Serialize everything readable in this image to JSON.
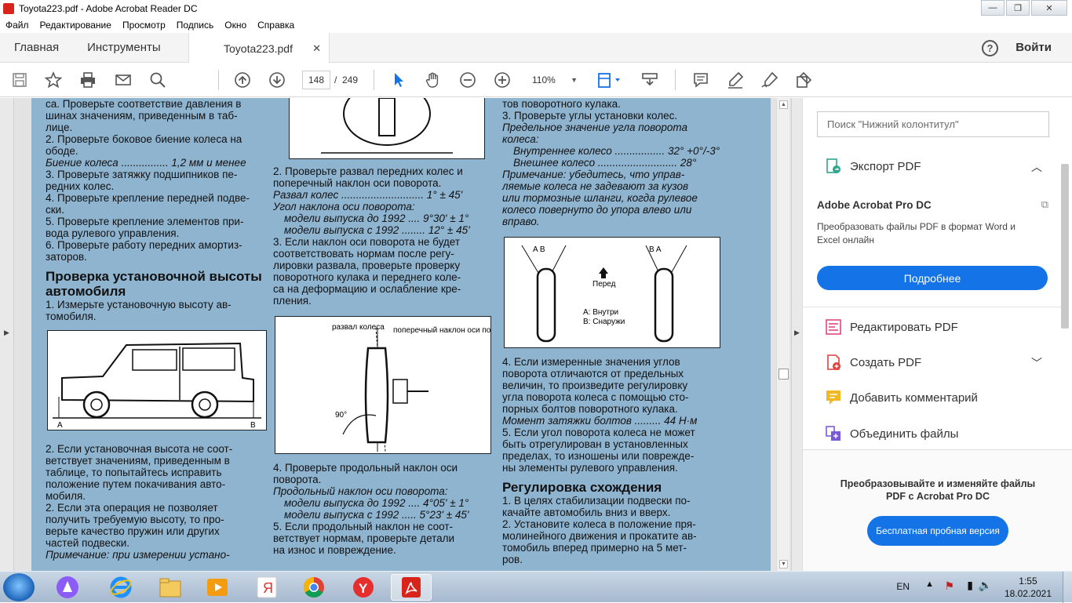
{
  "window": {
    "title": "Toyota223.pdf - Adobe Acrobat Reader DC",
    "minimize": "—",
    "maximize": "❐",
    "close": "✕"
  },
  "menu": [
    "Файл",
    "Редактирование",
    "Просмотр",
    "Подпись",
    "Окно",
    "Справка"
  ],
  "tabs": {
    "home": "Главная",
    "tools": "Инструменты",
    "document": "Toyota223.pdf",
    "close": "✕",
    "signin": "Войти"
  },
  "toolbar": {
    "page_current": "148",
    "page_separator": "/",
    "page_total": "249",
    "zoom": "110%"
  },
  "document": {
    "col1": [
      "са. Проверьте соответствие давления в",
      "шинах значениям, приведенным в таб-",
      "лице.",
      "2. Проверьте боковое биение колеса на",
      "ободе.",
      "Биение колеса ................ 1,2 мм и менее",
      "3. Проверьте затяжку подшипников пе-",
      "редних колес.",
      "4. Проверьте крепление передней подве-",
      "ски.",
      "5. Проверьте крепление элементов при-",
      "вода рулевого управления.",
      "6. Проверьте работу передних амортиз-",
      "заторов."
    ],
    "col1_heading": "Проверка установочной высоты автомобиля",
    "col1_b": [
      "1. Измерьте установочную высоту ав-",
      "томобиля."
    ],
    "col1_fig_labels": {
      "a": "A",
      "b": "B"
    },
    "col1_c": [
      "2. Если установочная высота не соот-",
      "ветствует значениям, приведенным в",
      "таблице, то попытайтесь исправить",
      "положение путем покачивания авто-",
      "мобиля.",
      "2. Если эта операция не позволяет",
      "получить требуемую высоту, то про-",
      "верьте качество пружин или других",
      "частей подвески.",
      "Примечание: при измерении устано-"
    ],
    "col2": [
      "2. Проверьте развал передних колес и",
      "поперечный наклон оси поворота.",
      "Развал колес ............................ 1° ± 45'",
      "Угол наклона оси поворота:",
      "модели выпуска до 1992 .... 9°30' ± 1°",
      "модели выпуска с 1992 ........ 12° ± 45'",
      "3. Если наклон оси поворота не будет",
      "соответствовать нормам после регу-",
      "лировки развала, проверьте проверку",
      "поворотного кулака и переднего коле-",
      "са на деформацию и ослабление кре-",
      "пления."
    ],
    "col2_fig_labels": {
      "camber": "развал колеса",
      "kingpin": "поперечный наклон оси поворота",
      "angle": "90°"
    },
    "col2_b": [
      "4. Проверьте продольный наклон оси",
      "поворота.",
      "Продольный наклон оси поворота:",
      "модели выпуска до 1992 .... 4°05' ± 1°",
      "модели выпуска с 1992 ..... 5°23' ± 45'",
      "5. Если продольный наклон не соот-",
      "ветствует нормам, проверьте детали",
      "на износ и повреждение."
    ],
    "col3": [
      "тов поворотного кулака.",
      "3. Проверьте углы установки колес.",
      "Предельное значение угла поворота",
      "колеса:",
      "Внутреннее колесо ................. 32° +0°/-3°",
      "Внешнее колесо ........................... 28°",
      "Примечание: убедитесь, что управ-",
      "ляемые колеса не задевают за кузов",
      "или тормозные шланги, когда рулевое",
      "колесо повернуто до упора влево или",
      "вправо."
    ],
    "col3_fig_labels": {
      "ab_left": "A B",
      "ba_right": "B A",
      "front": "Перед",
      "inside": "A: Внутри",
      "outside": "B: Снаружи"
    },
    "col3_b": [
      "4. Если измеренные значения углов",
      "поворота отличаются от предельных",
      "величин, то произведите регулировку",
      "угла поворота колеса с помощью сто-",
      "порных болтов поворотного кулака.",
      "Момент затяжки болтов ......... 44 Н·м",
      "5. Если угол поворота колеса не может",
      "быть отрегулирован в установленных",
      "пределах, то изношены или поврежде-",
      "ны элементы рулевого управления."
    ],
    "col3_heading": "Регулировка схождения",
    "col3_c": [
      "1. В целях стабилизации подвески по-",
      "качайте автомобиль вниз и вверх.",
      "2. Установите колеса в положение пря-",
      "молинейного движения и прокатите ав-",
      "томобиль вперед примерно на 5 мет-",
      "ров."
    ]
  },
  "right_pane": {
    "search_placeholder": "Поиск \"Нижний колонтитул\"",
    "export_pdf": "Экспорт PDF",
    "acrobat_title": "Adobe Acrobat Pro DC",
    "acrobat_desc": "Преобразовать файлы PDF в формат Word и Excel онлайн",
    "more_button": "Подробнее",
    "edit_pdf": "Редактировать PDF",
    "create_pdf": "Создать PDF",
    "add_comment": "Добавить комментарий",
    "combine_files": "Объединить файлы",
    "promo_text": "Преобразовывайте и изменяйте файлы PDF с Acrobat Pro DC",
    "trial_button": "Бесплатная пробная версия"
  },
  "taskbar": {
    "lang": "EN",
    "time": "1:55",
    "date": "18.02.2021"
  },
  "colors": {
    "page_bg": "#8fb4d0",
    "accent": "#1473e6",
    "acrobat_red": "#d9241c"
  }
}
